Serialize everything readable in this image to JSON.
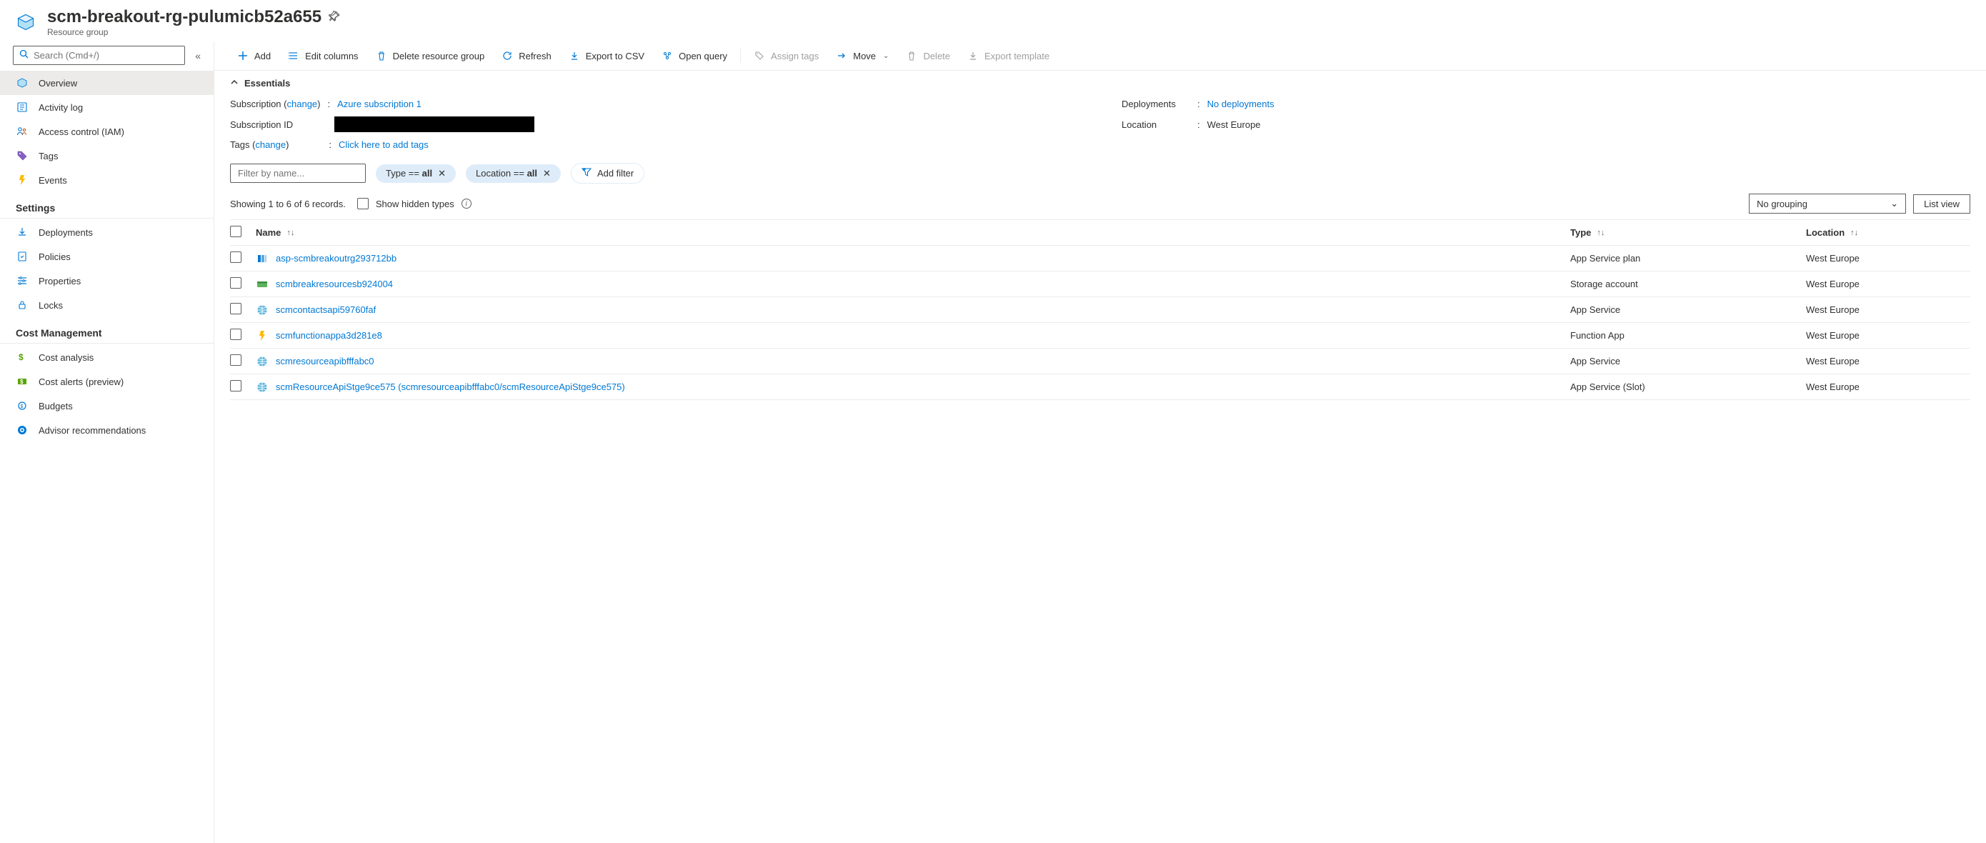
{
  "header": {
    "title": "scm-breakout-rg-pulumicb52a655",
    "subtitle": "Resource group"
  },
  "sidebar": {
    "search_placeholder": "Search (Cmd+/)",
    "nav": {
      "overview": "Overview",
      "activity_log": "Activity log",
      "iam": "Access control (IAM)",
      "tags": "Tags",
      "events": "Events"
    },
    "sections": {
      "settings": "Settings",
      "cost": "Cost Management"
    },
    "settings": {
      "deployments": "Deployments",
      "policies": "Policies",
      "properties": "Properties",
      "locks": "Locks"
    },
    "cost": {
      "analysis": "Cost analysis",
      "alerts": "Cost alerts (preview)",
      "budgets": "Budgets",
      "advisor": "Advisor recommendations"
    }
  },
  "toolbar": {
    "add": "Add",
    "edit_columns": "Edit columns",
    "delete_rg": "Delete resource group",
    "refresh": "Refresh",
    "export_csv": "Export to CSV",
    "open_query": "Open query",
    "assign_tags": "Assign tags",
    "move": "Move",
    "delete": "Delete",
    "export_template": "Export template"
  },
  "essentials": {
    "toggle": "Essentials",
    "subscription_label": "Subscription",
    "change": "change",
    "subscription_value": "Azure subscription 1",
    "sub_id_label": "Subscription ID",
    "tags_label": "Tags",
    "tags_value": "Click here to add tags",
    "deployments_label": "Deployments",
    "deployments_value": "No deployments",
    "location_label": "Location",
    "location_value": "West Europe"
  },
  "filters": {
    "filter_placeholder": "Filter by name...",
    "type_label": "Type ==",
    "type_value": "all",
    "location_label": "Location ==",
    "location_value": "all",
    "add_filter": "Add filter"
  },
  "records": {
    "summary": "Showing 1 to 6 of 6 records.",
    "show_hidden": "Show hidden types",
    "grouping": "No grouping",
    "list_view": "List view"
  },
  "table": {
    "headers": {
      "name": "Name",
      "type": "Type",
      "location": "Location"
    },
    "rows": [
      {
        "name": "asp-scmbreakoutrg293712bb",
        "type": "App Service plan",
        "location": "West Europe",
        "icon": "app-service-plan"
      },
      {
        "name": "scmbreakresourcesb924004",
        "type": "Storage account",
        "location": "West Europe",
        "icon": "storage"
      },
      {
        "name": "scmcontactsapi59760faf",
        "type": "App Service",
        "location": "West Europe",
        "icon": "app-service"
      },
      {
        "name": "scmfunctionappa3d281e8",
        "type": "Function App",
        "location": "West Europe",
        "icon": "function"
      },
      {
        "name": "scmresourceapibfffabc0",
        "type": "App Service",
        "location": "West Europe",
        "icon": "app-service"
      },
      {
        "name": "scmResourceApiStge9ce575 (scmresourceapibfffabc0/scmResourceApiStge9ce575)",
        "type": "App Service (Slot)",
        "location": "West Europe",
        "icon": "app-service"
      }
    ]
  }
}
